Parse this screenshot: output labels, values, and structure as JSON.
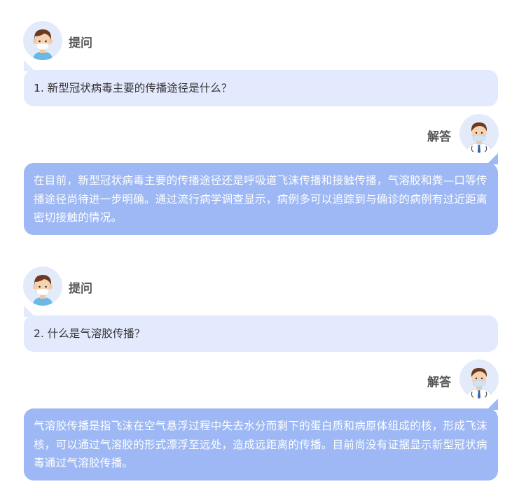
{
  "conversation": [
    {
      "question_role": "提问",
      "question": "1. 新型冠状病毒主要的传播途径是什么？",
      "answer_role": "解答",
      "answer": "在目前，新型冠状病毒主要的传播途径还是呼吸道飞沫传播和接触传播，气溶胶和粪—口等传播途径尚待进一步明确。通过流行病学调查显示，病例多可以追踪到与确诊的病例有过近距离密切接触的情况。"
    },
    {
      "question_role": "提问",
      "question": "2. 什么是气溶胶传播？",
      "answer_role": "解答",
      "answer": "气溶胶传播是指飞沫在空气悬浮过程中失去水分而剩下的蛋白质和病原体组成的核，形成飞沫核，可以通过气溶胶的形式漂浮至远处，造成远距离的传播。目前尚没有证据显示新型冠状病毒通过气溶胶传播。"
    }
  ],
  "icons": {
    "asker_avatar": "patient-avatar-icon",
    "doctor_avatar": "doctor-avatar-icon"
  },
  "colors": {
    "question_bubble": "#e3eafd",
    "answer_bubble": "#9db8f4",
    "avatar_bg": "#e3ebfb"
  }
}
